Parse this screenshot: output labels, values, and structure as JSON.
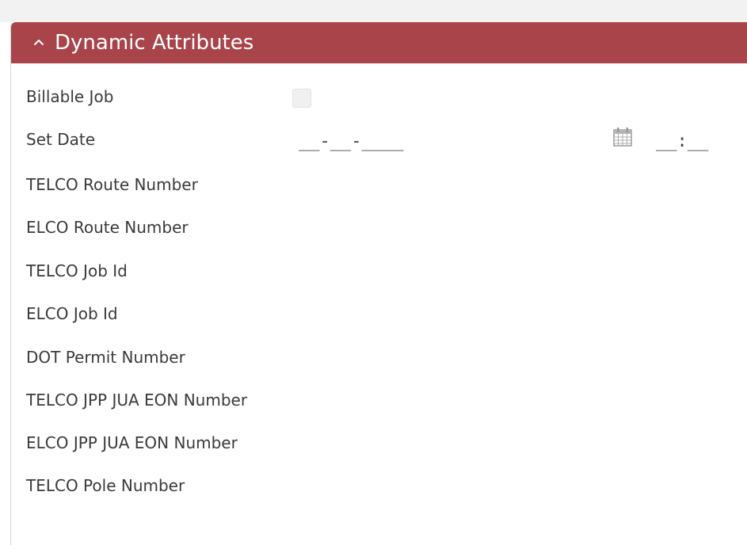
{
  "section": {
    "title": "Dynamic Attributes",
    "collapse_icon": "chevron-up-icon"
  },
  "fields": {
    "billable_job": {
      "label": "Billable Job",
      "checked": false
    },
    "set_date": {
      "label": "Set Date",
      "date_value": "__-__-____",
      "time_value": "__:__",
      "calendar_icon": "calendar-icon"
    },
    "telco_route_number": {
      "label": "TELCO Route Number"
    },
    "elco_route_number": {
      "label": "ELCO Route Number"
    },
    "telco_job_id": {
      "label": "TELCO Job Id"
    },
    "elco_job_id": {
      "label": "ELCO Job Id"
    },
    "dot_permit_number": {
      "label": "DOT Permit Number"
    },
    "telco_jpp_jua_eon_number": {
      "label": "TELCO JPP JUA EON Number"
    },
    "elco_jpp_jua_eon_number": {
      "label": "ELCO JPP JUA EON Number"
    },
    "telco_pole_number": {
      "label": "TELCO Pole Number"
    }
  },
  "colors": {
    "header_bg": "#a8444a",
    "header_text": "#ffffff",
    "label_text": "#3a3a3a"
  }
}
